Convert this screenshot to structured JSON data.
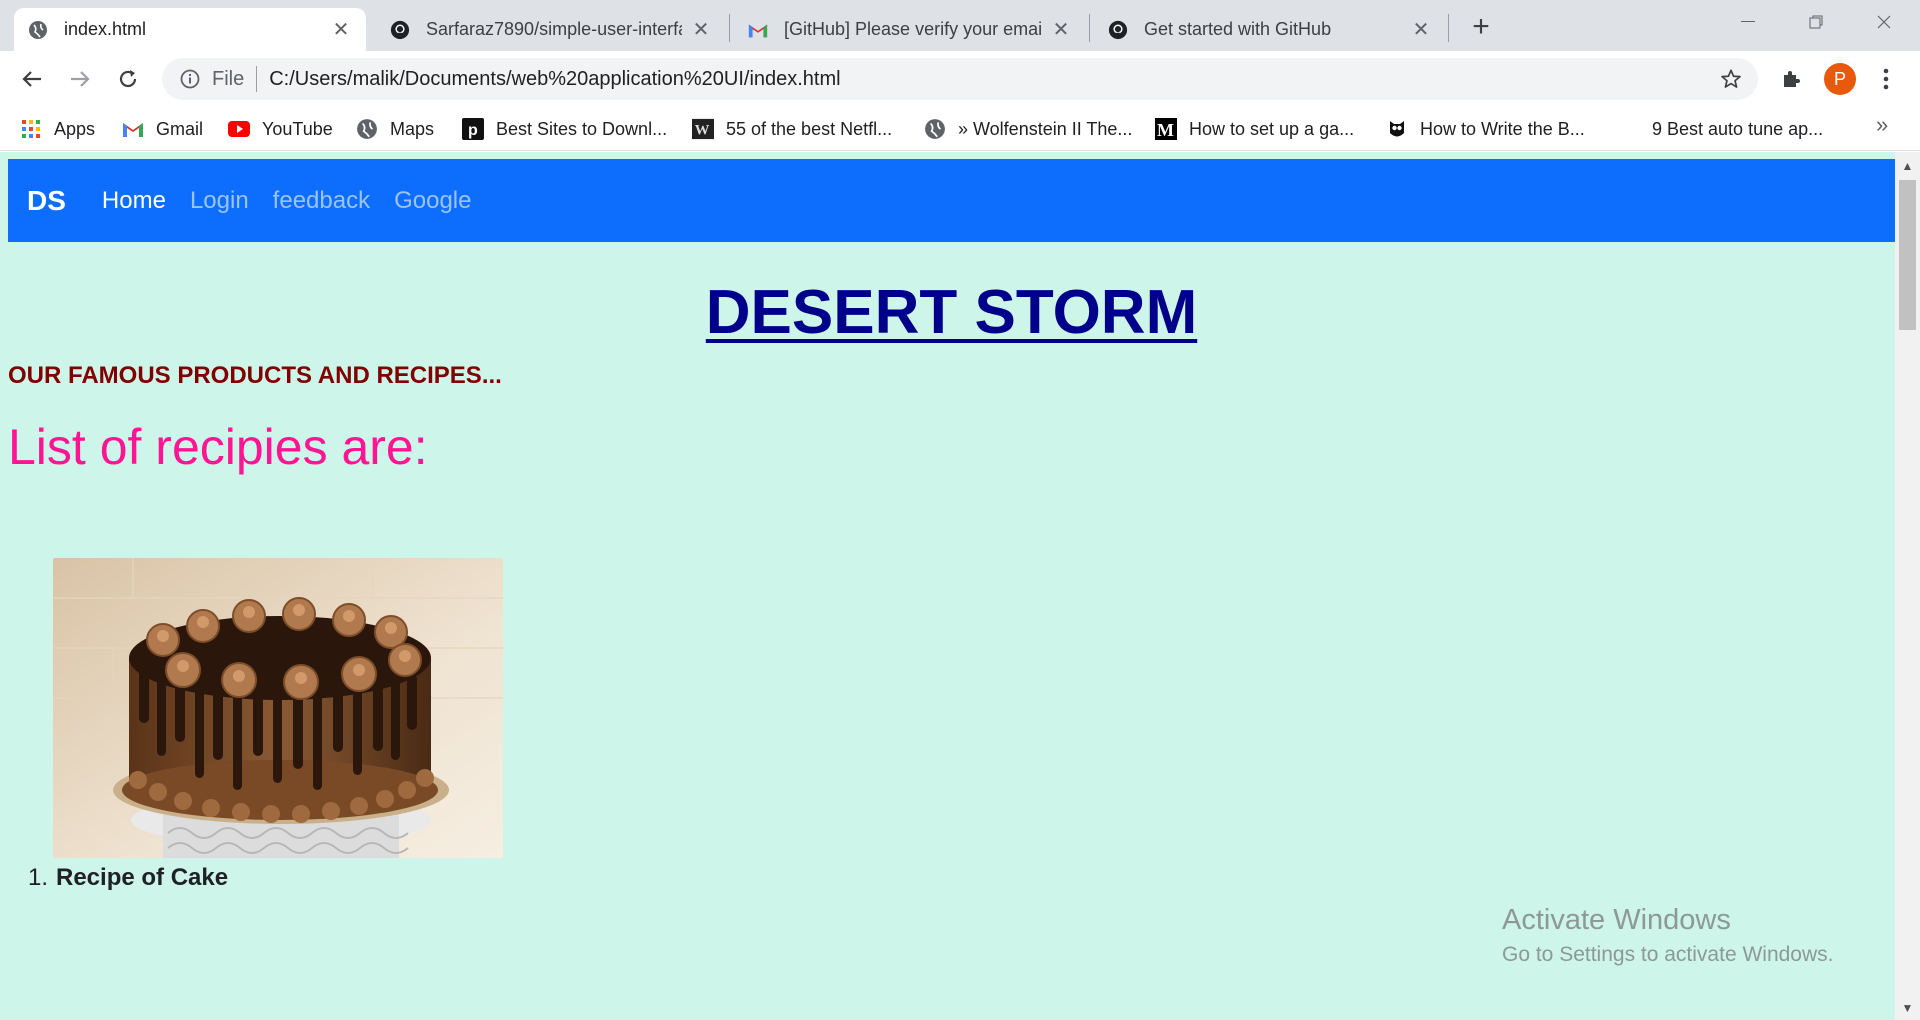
{
  "tabs": [
    {
      "title": "index.html",
      "icon": "globe-icon",
      "active": true
    },
    {
      "title": "Sarfaraz7890/simple-user-interfa",
      "icon": "github-icon",
      "active": false
    },
    {
      "title": "[GitHub] Please verify your email",
      "icon": "gmail-icon",
      "active": false
    },
    {
      "title": "Get started with GitHub",
      "icon": "github-icon",
      "active": false
    }
  ],
  "omnibox": {
    "scheme_label": "File",
    "url": "C:/Users/malik/Documents/web%20application%20UI/index.html"
  },
  "profile": {
    "initial": "P",
    "color": "#e8590c"
  },
  "bookmarks": [
    {
      "label": "Apps",
      "icon": "apps-grid-icon"
    },
    {
      "label": "Gmail",
      "icon": "gmail-icon"
    },
    {
      "label": "YouTube",
      "icon": "youtube-icon"
    },
    {
      "label": "Maps",
      "icon": "globe-icon"
    },
    {
      "label": "Best Sites to Downl...",
      "icon": "p-logo-icon"
    },
    {
      "label": "55 of the best Netfl...",
      "icon": "w-logo-icon"
    },
    {
      "label": "» Wolfenstein II The...",
      "icon": "globe-icon"
    },
    {
      "label": "How to set up a ga...",
      "icon": "medium-logo-icon"
    },
    {
      "label": "How to Write the B...",
      "icon": "owl-icon"
    },
    {
      "label": "9 Best auto tune ap...",
      "icon": ""
    }
  ],
  "site": {
    "brand": "DS",
    "nav": [
      {
        "label": "Home",
        "active": true
      },
      {
        "label": "Login",
        "active": false
      },
      {
        "label": "feedback",
        "active": false
      },
      {
        "label": "Google",
        "active": false
      }
    ],
    "title": "DESERT STORM",
    "subheading": "OUR FAMOUS PRODUCTS AND RECIPES...",
    "list_heading": "List of recipies are:",
    "recipes": [
      {
        "number": "1.",
        "label": "Recipe of Cake",
        "image": "chocolate-cake-image"
      }
    ],
    "colors": {
      "navbar": "#0d6efd",
      "page_background": "#cdf5ea",
      "title": "#00008b",
      "subheading": "#800000",
      "list_heading": "#ff1493"
    }
  },
  "watermark": {
    "line1": "Activate Windows",
    "line2": "Go to Settings to activate Windows."
  }
}
